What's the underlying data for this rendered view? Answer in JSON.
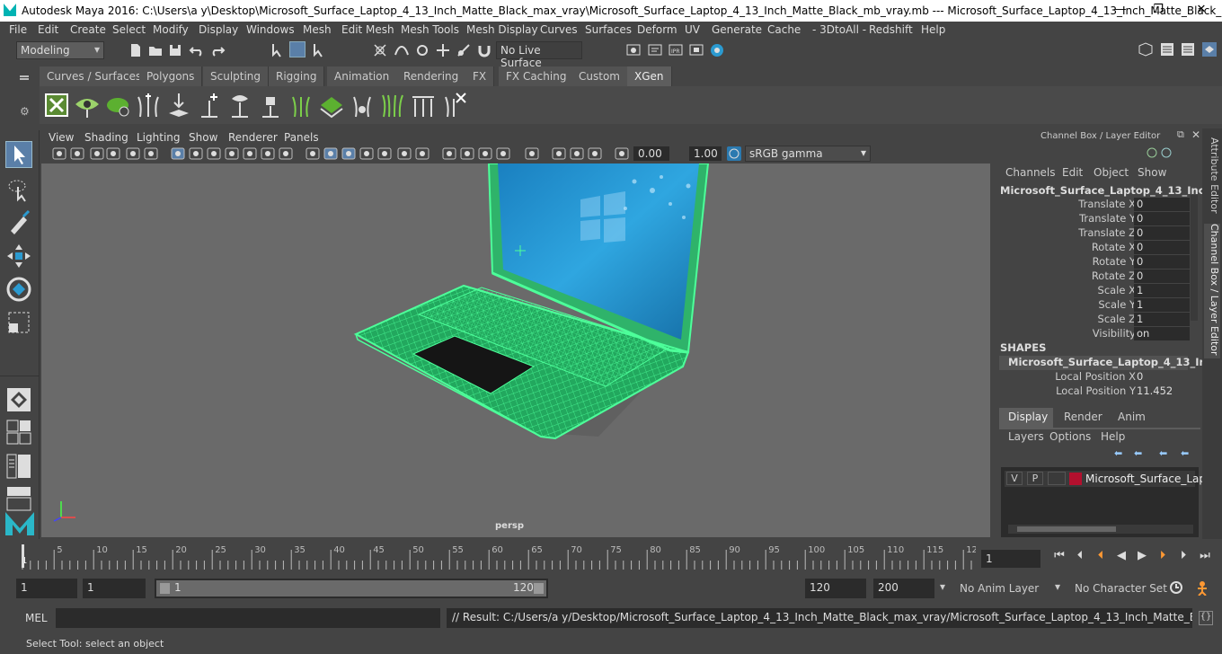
{
  "window": {
    "title": "Autodesk Maya 2016: C:\\Users\\a y\\Desktop\\Microsoft_Surface_Laptop_4_13_Inch_Matte_Black_max_vray\\Microsoft_Surface_Laptop_4_13_Inch_Matte_Black_mb_vray.mb  ---  Microsoft_Surface_Laptop_4_13_Inch_Matte_Black_...",
    "minimize": "—",
    "maximize": "❐",
    "close": "✕"
  },
  "menubar": [
    "File",
    "Edit",
    "Create",
    "Select",
    "Modify",
    "Display",
    "Windows",
    "Mesh",
    "Edit Mesh",
    "Mesh Tools",
    "Mesh Display",
    "Curves",
    "Surfaces",
    "Deform",
    "UV",
    "Generate",
    "Cache",
    "- 3DtoAll -",
    "Redshift",
    "Help"
  ],
  "statusline": {
    "mode": "Modeling",
    "live_surface": "No Live Surface"
  },
  "shelf": {
    "tabs": [
      "Curves / Surfaces",
      "Polygons",
      "Sculpting",
      "Rigging",
      "Animation",
      "Rendering",
      "FX",
      "FX Caching",
      "Custom",
      "XGen"
    ],
    "active_tab": "XGen"
  },
  "viewport": {
    "menus": [
      "View",
      "Shading",
      "Lighting",
      "Show",
      "Renderer",
      "Panels"
    ],
    "exposure": "0.00",
    "gamma": "1.00",
    "color_space": "sRGB gamma",
    "camera_label": "persp",
    "wire_color": "#4dff9a"
  },
  "channelbox": {
    "header": "Channel Box / Layer Editor",
    "menus": [
      "Channels",
      "Edit",
      "Object",
      "Show"
    ],
    "object_name": "Microsoft_Surface_Laptop_4_13_Inch_...",
    "attributes": [
      {
        "label": "Translate X",
        "value": "0"
      },
      {
        "label": "Translate Y",
        "value": "0"
      },
      {
        "label": "Translate Z",
        "value": "0"
      },
      {
        "label": "Rotate X",
        "value": "0"
      },
      {
        "label": "Rotate Y",
        "value": "0"
      },
      {
        "label": "Rotate Z",
        "value": "0"
      },
      {
        "label": "Scale X",
        "value": "1"
      },
      {
        "label": "Scale Y",
        "value": "1"
      },
      {
        "label": "Scale Z",
        "value": "1"
      },
      {
        "label": "Visibility",
        "value": "on"
      }
    ],
    "shapes_header": "SHAPES",
    "shape_name": "Microsoft_Surface_Laptop_4_13_Inc...",
    "shape_attributes": [
      {
        "label": "Local Position X",
        "value": "0"
      },
      {
        "label": "Local Position Y",
        "value": "11.452"
      }
    ],
    "side_tabs": [
      "Attribute Editor",
      "Channel Box / Layer Editor"
    ]
  },
  "layereditor": {
    "tabs": [
      "Display",
      "Render",
      "Anim"
    ],
    "active_tab": "Display",
    "menus": [
      "Layers",
      "Options",
      "Help"
    ],
    "layer": {
      "v": "V",
      "p": "P",
      "name": "Microsoft_Surface_Lapto",
      "color": "#b3102e"
    }
  },
  "timeline": {
    "ticks": [
      "5",
      "10",
      "15",
      "20",
      "25",
      "30",
      "35",
      "40",
      "45",
      "50",
      "55",
      "60",
      "65",
      "70",
      "75",
      "80",
      "85",
      "90",
      "95",
      "100",
      "105",
      "110",
      "115",
      "12"
    ],
    "start_marker": "1",
    "current_frame": "1"
  },
  "range": {
    "start": "1",
    "playback_start": "1",
    "slider_start": "1",
    "slider_end": "120",
    "playback_end": "120",
    "end": "200",
    "anim_layer": "No Anim Layer",
    "character_set": "No Character Set"
  },
  "cmdline": {
    "label": "MEL",
    "result": "// Result: C:/Users/a y/Desktop/Microsoft_Surface_Laptop_4_13_Inch_Matte_Black_max_vray/Microsoft_Surface_Laptop_4_13_Inch_Matte_Black_mb_vray.mb"
  },
  "helpline": "Select Tool: select an object"
}
